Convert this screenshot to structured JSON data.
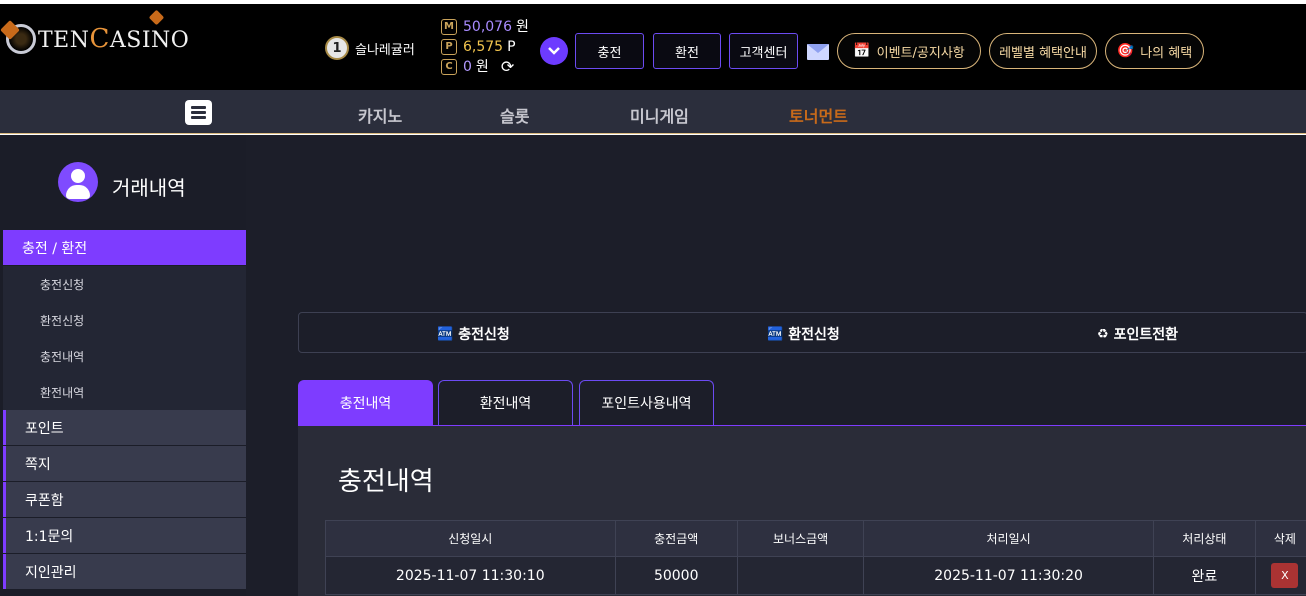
{
  "logo": {
    "prefix": "TEN",
    "c_letter": "C",
    "rest": "ASINO"
  },
  "user": {
    "level": "1",
    "name": "슬나레귤러"
  },
  "wallet": {
    "money": {
      "icon": "M",
      "value": "50,076",
      "unit": "원"
    },
    "point": {
      "icon": "P",
      "value": "6,575",
      "unit": "P"
    },
    "coupon": {
      "icon": "C",
      "value": "0",
      "unit": "원"
    }
  },
  "header": {
    "charge": "충전",
    "exchange": "환전",
    "support": "고객센터",
    "events": "이벤트/공지사항",
    "level_benefit": "레벨별 혜택안내",
    "my_benefit": "나의 혜택"
  },
  "nav": {
    "items": [
      "카지노",
      "슬롯",
      "미니게임",
      "토너먼트"
    ],
    "highlight_color": "#c86a1a"
  },
  "sidebar": {
    "title": "거래내역",
    "section": "충전 / 환전",
    "sub_items": [
      "충전신청",
      "환전신청",
      "충전내역",
      "환전내역"
    ],
    "items": [
      "포인트",
      "쪽지",
      "쿠폰함",
      "1:1문의",
      "지인관리"
    ]
  },
  "actions": {
    "charge_request": "충전신청",
    "exchange_request": "환전신청",
    "point_convert": "포인트전환"
  },
  "tabs": [
    "충전내역",
    "환전내역",
    "포인트사용내역"
  ],
  "panel": {
    "title": "충전내역",
    "columns": [
      "신청일시",
      "충전금액",
      "보너스금액",
      "처리일시",
      "처리상태",
      "삭제"
    ],
    "rows": [
      {
        "requested": "2025-11-07 11:30:10",
        "amount": "50000",
        "bonus": "",
        "processed": "2025-11-07 11:30:20",
        "status": "완료",
        "delete": "X"
      }
    ]
  },
  "colors": {
    "accent": "#7e3cff",
    "gold": "#d9b57a",
    "danger": "#aa3333"
  }
}
